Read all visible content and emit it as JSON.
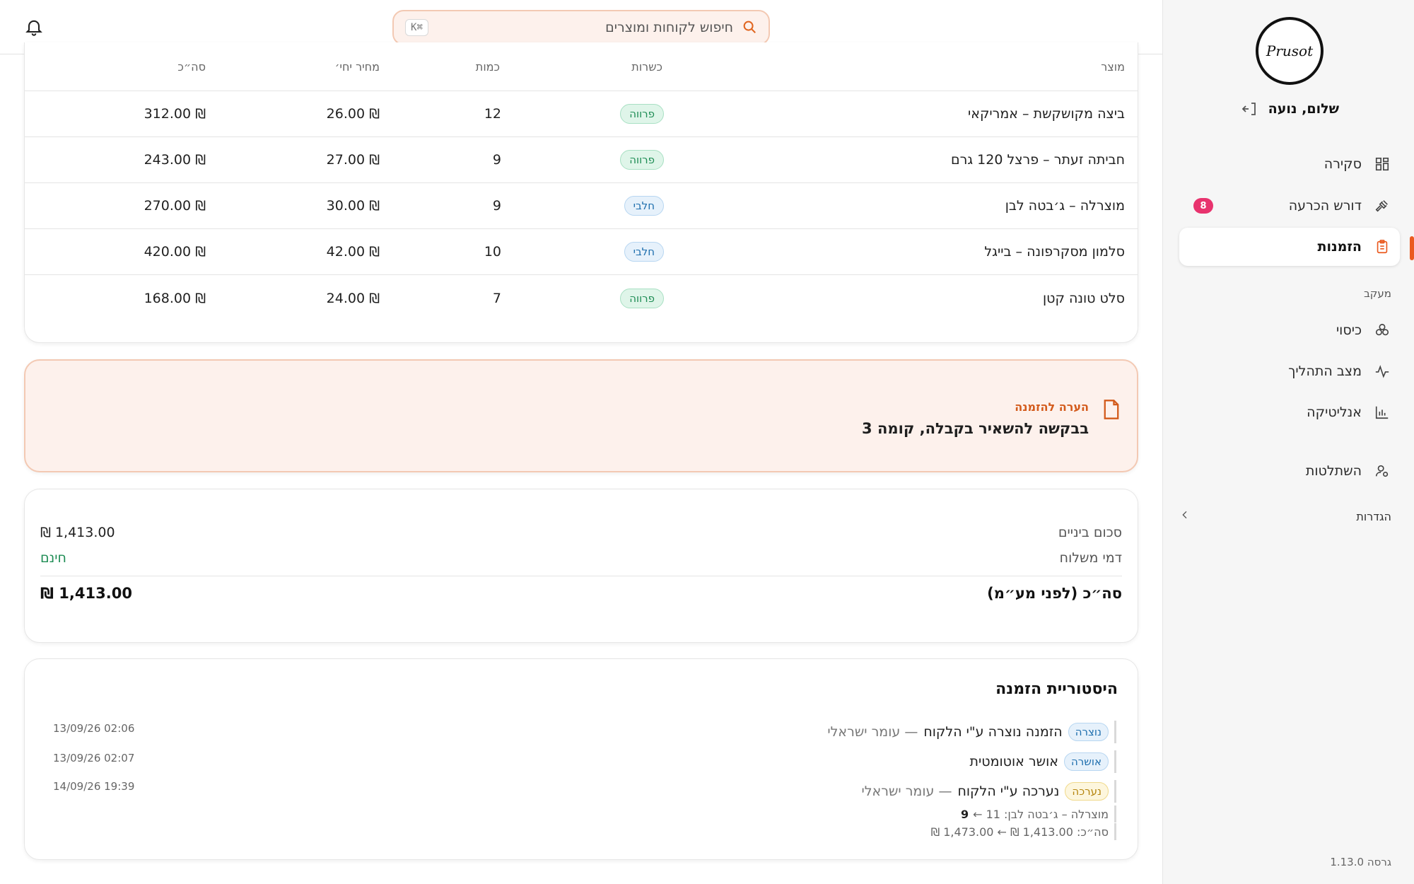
{
  "header": {
    "search_placeholder": "חיפוש לקוחות ומוצרים",
    "shortcut": "⌘K"
  },
  "sidebar": {
    "logo_text": "Prusot",
    "greeting": "שלום, נועה",
    "nav": [
      {
        "label": "סקירה",
        "icon": "grid-icon"
      },
      {
        "label": "דורש הכרעה",
        "icon": "gavel-icon",
        "badge": "8"
      },
      {
        "label": "הזמנות",
        "icon": "clipboard-icon",
        "active": true
      }
    ],
    "tracking_label": "מעקב",
    "tracking": [
      {
        "label": "כיסוי",
        "icon": "layers-icon"
      },
      {
        "label": "מצב התהליך",
        "icon": "activity-icon"
      },
      {
        "label": "אנליטיקה",
        "icon": "bar-chart-icon"
      }
    ],
    "impersonate": {
      "label": "השתלטות",
      "icon": "user-cog-icon"
    },
    "settings_label": "הגדרות",
    "version": "גרסה 1.13.0"
  },
  "table": {
    "headers": {
      "product": "מוצר",
      "kosher": "כשרות",
      "qty": "כמות",
      "unit": "מחיר יחי׳",
      "total": "סה״כ"
    },
    "rows": [
      {
        "product": "ביצה מקושקשת – אמריקאי",
        "kosher": "פרווה",
        "kind": "parve",
        "qty": "12",
        "unit": "₪ 26.00",
        "total": "₪ 312.00"
      },
      {
        "product": "חביתה זעתר – פרצל 120 גרם",
        "kosher": "פרווה",
        "kind": "parve",
        "qty": "9",
        "unit": "₪ 27.00",
        "total": "₪ 243.00"
      },
      {
        "product": "מוצרלה – ג׳בטה לבן",
        "kosher": "חלבי",
        "kind": "dairy",
        "qty": "9",
        "unit": "₪ 30.00",
        "total": "₪ 270.00"
      },
      {
        "product": "סלמון מסקרפונה – בייגל",
        "kosher": "חלבי",
        "kind": "dairy",
        "qty": "10",
        "unit": "₪ 42.00",
        "total": "₪ 420.00"
      },
      {
        "product": "סלט טונה קטן",
        "kosher": "פרווה",
        "kind": "parve",
        "qty": "7",
        "unit": "₪ 24.00",
        "total": "₪ 168.00"
      }
    ]
  },
  "note": {
    "label": "הערה להזמנה",
    "text": "בבקשה להשאיר בקבלה, קומה 3"
  },
  "summary": {
    "subtotal_label": "סכום ביניים",
    "subtotal_value": "₪ 1,413.00",
    "shipping_label": "דמי משלוח",
    "shipping_value": "חינם",
    "total_label": "סה״כ (לפני מע״מ)",
    "total_value": "₪ 1,413.00"
  },
  "history": {
    "title": "היסטוריית הזמנה",
    "events": [
      {
        "status": "נוצרה",
        "kind": "created",
        "text": "הזמנה נוצרה ע\"י הלקוח",
        "actor": "— עומר ישראלי",
        "time": "13/09/26 02:06"
      },
      {
        "status": "אושרה",
        "kind": "approved",
        "text": "אושר אוטומטית",
        "actor": "",
        "time": "13/09/26 02:07"
      },
      {
        "status": "נערכה",
        "kind": "edited",
        "text": "נערכה ע\"י הלקוח",
        "actor": "— עומר ישראלי",
        "time": "14/09/26 19:39"
      }
    ],
    "details": [
      {
        "text": "מוצרלה – ג׳בטה לבן: 11 ←",
        "strong": "9"
      },
      {
        "text": "סה״כ: ‎₪ 1,473.00‎ ← ‎₪ 1,413.00‎",
        "strong": ""
      }
    ]
  },
  "colors": {
    "accent": "#ea5a1f",
    "badge": "#e8336e",
    "parve": "#1f8d55",
    "dairy": "#1f6fae"
  }
}
